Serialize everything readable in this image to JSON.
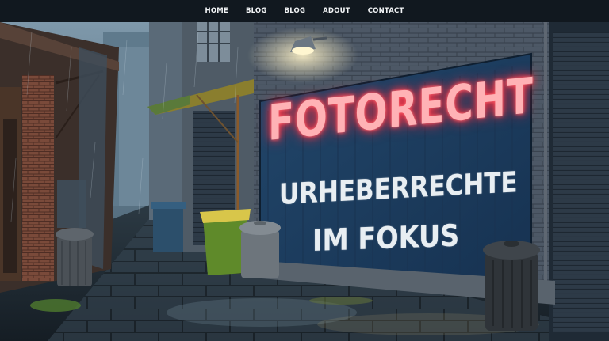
{
  "nav": {
    "items": [
      {
        "label": "HOME"
      },
      {
        "label": "BLOG"
      },
      {
        "label": "BLOG"
      },
      {
        "label": "ADOUT"
      },
      {
        "label": "CONTACT"
      }
    ]
  },
  "hero": {
    "neon_sign": "FOTORECHT",
    "mural_line_1": "URHEBERRECHTE",
    "mural_line_2": "IM FOKUS"
  },
  "colors": {
    "nav_bg": "#11181f",
    "neon": "#ff3b4a",
    "mural_bg": "#1c3b5c",
    "wall": "#4a5562"
  }
}
